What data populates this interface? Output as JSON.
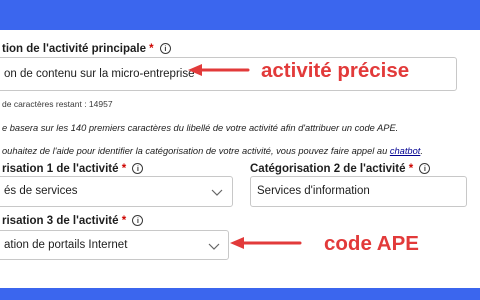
{
  "activity": {
    "label": "tion de l'activité principale",
    "required_mark": "*",
    "info_glyph": "i",
    "value": "on de contenu sur la micro-entreprise",
    "counter": "de caractères restant : 14957"
  },
  "notes": {
    "ape_notice": "e basera sur les 140 premiers caractères du libellé de votre activité afin d'attribuer un code APE.",
    "help_prefix": "ouhaitez de l'aide pour identifier la catégorisation de votre activité, vous pouvez faire appel au ",
    "help_link": "chatbot",
    "help_suffix": "."
  },
  "cat1": {
    "label": "risation 1 de l'activité",
    "required_mark": "*",
    "info_glyph": "i",
    "value": "és de services"
  },
  "cat2": {
    "label": "Catégorisation 2 de l'activité",
    "required_mark": "*",
    "info_glyph": "i",
    "value": "Services d'information"
  },
  "cat3": {
    "label": "risation 3 de l'activité",
    "required_mark": "*",
    "info_glyph": "i",
    "value": "ation de portails Internet"
  },
  "annotations": {
    "top": "activité précise",
    "bottom": "code APE"
  },
  "colors": {
    "background": "#3b66ee",
    "annotation": "#e23a3a",
    "required": "#ce0500",
    "link": "#000091"
  }
}
